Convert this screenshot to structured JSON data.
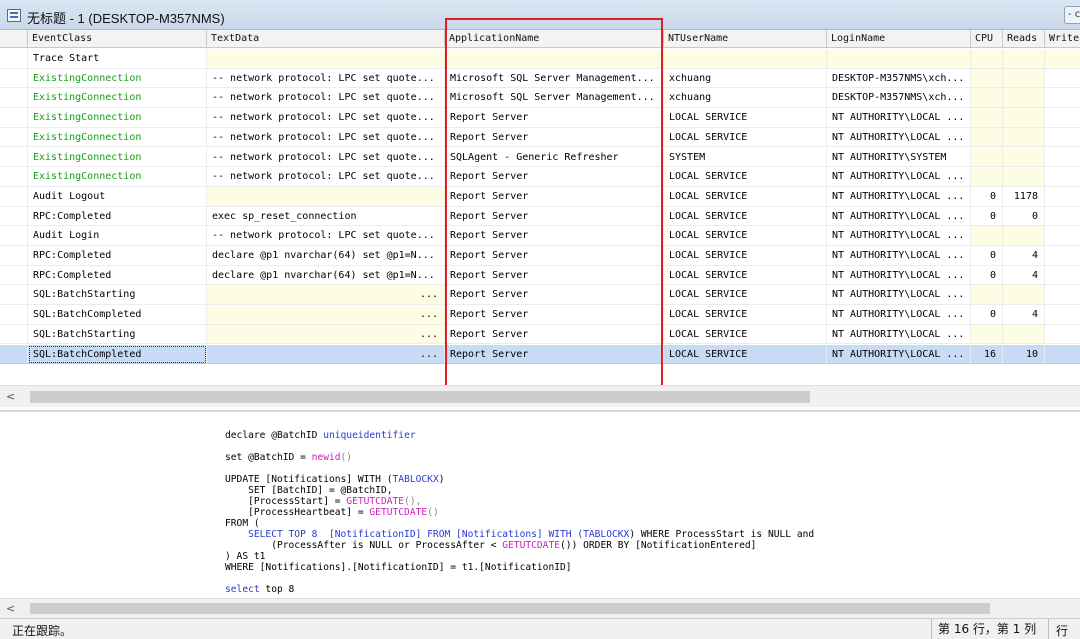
{
  "window": {
    "title": "无标题 - 1 (DESKTOP-M357NMS)",
    "button_label": "- c"
  },
  "grid": {
    "columns": [
      "EventClass",
      "TextData",
      "ApplicationName",
      "NTUserName",
      "LoginName",
      "CPU",
      "Reads",
      "Writes"
    ],
    "rows": [
      {
        "event": "Trace Start",
        "text": "",
        "app": "",
        "user": "",
        "login": "",
        "cpu": "",
        "reads": "",
        "style": "plain"
      },
      {
        "event": "ExistingConnection",
        "text": "-- network protocol: LPC  set quote...",
        "app": "Microsoft SQL Server Management...",
        "user": "xchuang",
        "login": "DESKTOP-M357NMS\\xch...",
        "cpu": "",
        "reads": "",
        "style": "green"
      },
      {
        "event": "ExistingConnection",
        "text": "-- network protocol: LPC  set quote...",
        "app": "Microsoft SQL Server Management...",
        "user": "xchuang",
        "login": "DESKTOP-M357NMS\\xch...",
        "cpu": "",
        "reads": "",
        "style": "green"
      },
      {
        "event": "ExistingConnection",
        "text": "-- network protocol: LPC  set quote...",
        "app": "Report Server",
        "user": "LOCAL SERVICE",
        "login": "NT AUTHORITY\\LOCAL ...",
        "cpu": "",
        "reads": "",
        "style": "green"
      },
      {
        "event": "ExistingConnection",
        "text": "-- network protocol: LPC  set quote...",
        "app": "Report Server",
        "user": "LOCAL SERVICE",
        "login": "NT AUTHORITY\\LOCAL ...",
        "cpu": "",
        "reads": "",
        "style": "green"
      },
      {
        "event": "ExistingConnection",
        "text": "-- network protocol: LPC  set quote...",
        "app": "SQLAgent - Generic Refresher",
        "user": "SYSTEM",
        "login": "NT AUTHORITY\\SYSTEM",
        "cpu": "",
        "reads": "",
        "style": "green"
      },
      {
        "event": "ExistingConnection",
        "text": "-- network protocol: LPC  set quote...",
        "app": "Report Server",
        "user": "LOCAL SERVICE",
        "login": "NT AUTHORITY\\LOCAL ...",
        "cpu": "",
        "reads": "",
        "style": "green"
      },
      {
        "event": "Audit Logout",
        "text": "",
        "app": "Report Server",
        "user": "LOCAL SERVICE",
        "login": "NT AUTHORITY\\LOCAL ...",
        "cpu": "0",
        "reads": "1178",
        "style": "plain"
      },
      {
        "event": "RPC:Completed",
        "text": "exec sp_reset_connection",
        "app": "Report Server",
        "user": "LOCAL SERVICE",
        "login": "NT AUTHORITY\\LOCAL ...",
        "cpu": "0",
        "reads": "0",
        "style": "plain"
      },
      {
        "event": "Audit Login",
        "text": "-- network protocol: LPC  set quote...",
        "app": "Report Server",
        "user": "LOCAL SERVICE",
        "login": "NT AUTHORITY\\LOCAL ...",
        "cpu": "",
        "reads": "",
        "style": "plain"
      },
      {
        "event": "RPC:Completed",
        "text": "declare @p1 nvarchar(64)  set @p1=N...",
        "app": "Report Server",
        "user": "LOCAL SERVICE",
        "login": "NT AUTHORITY\\LOCAL ...",
        "cpu": "0",
        "reads": "4",
        "style": "plain"
      },
      {
        "event": "RPC:Completed",
        "text": "declare @p1 nvarchar(64)  set @p1=N...",
        "app": "Report Server",
        "user": "LOCAL SERVICE",
        "login": "NT AUTHORITY\\LOCAL ...",
        "cpu": "0",
        "reads": "4",
        "style": "plain"
      },
      {
        "event": "SQL:BatchStarting",
        "text": "...",
        "app": "Report Server",
        "user": "LOCAL SERVICE",
        "login": "NT AUTHORITY\\LOCAL ...",
        "cpu": "",
        "reads": "",
        "style": "plain"
      },
      {
        "event": "SQL:BatchCompleted",
        "text": "...",
        "app": "Report Server",
        "user": "LOCAL SERVICE",
        "login": "NT AUTHORITY\\LOCAL ...",
        "cpu": "0",
        "reads": "4",
        "style": "plain"
      },
      {
        "event": "SQL:BatchStarting",
        "text": "...",
        "app": "Report Server",
        "user": "LOCAL SERVICE",
        "login": "NT AUTHORITY\\LOCAL ...",
        "cpu": "",
        "reads": "",
        "style": "plain"
      },
      {
        "event": "SQL:BatchCompleted",
        "text": "...",
        "app": "Report Server",
        "user": "LOCAL SERVICE",
        "login": "NT AUTHORITY\\LOCAL ...",
        "cpu": "16",
        "reads": "10",
        "style": "selected"
      }
    ]
  },
  "sql_text": {
    "line1_a": "declare @BatchID ",
    "line1_b": "uniqueidentifier",
    "line2_a": "set @BatchID = ",
    "line2_b": "newid",
    "line2_c": "()",
    "line3": "UPDATE [Notifications] WITH (",
    "line3_b": "TABLOCKX",
    "line3_c": ")",
    "line4": "    SET [BatchID] = @BatchID,",
    "line5_a": "    [ProcessStart] = ",
    "line5_b": "GETUTCDATE",
    "line5_c": "(),",
    "line6_a": "    [ProcessHeartbeat] = ",
    "line6_b": "GETUTCDATE",
    "line6_c": "()",
    "line7": "FROM (",
    "line8_a": "    SELECT TOP 8  [NotificationID] FROM [Notifications] WITH (",
    "line8_b": "TABLOCKX",
    "line8_c": ") WHERE ProcessStart is NULL and",
    "line9_a": "        (ProcessAfter is NULL or ProcessAfter < ",
    "line9_b": "GETUTCDATE",
    "line9_c": "()) ORDER BY [NotificationEntered]",
    "line10": ") AS t1",
    "line11": "WHERE [Notifications].[NotificationID] = t1.[NotificationID]",
    "line12_a": "select",
    "line12_b": " top 8"
  },
  "status": {
    "left": "正在跟踪。",
    "position": "第 16 行，第 1 列",
    "extra": "行"
  },
  "scroll": {
    "left_arrow": "<"
  },
  "highlight_color": "#e02020",
  "selected_row_color": "#c7dcf4"
}
